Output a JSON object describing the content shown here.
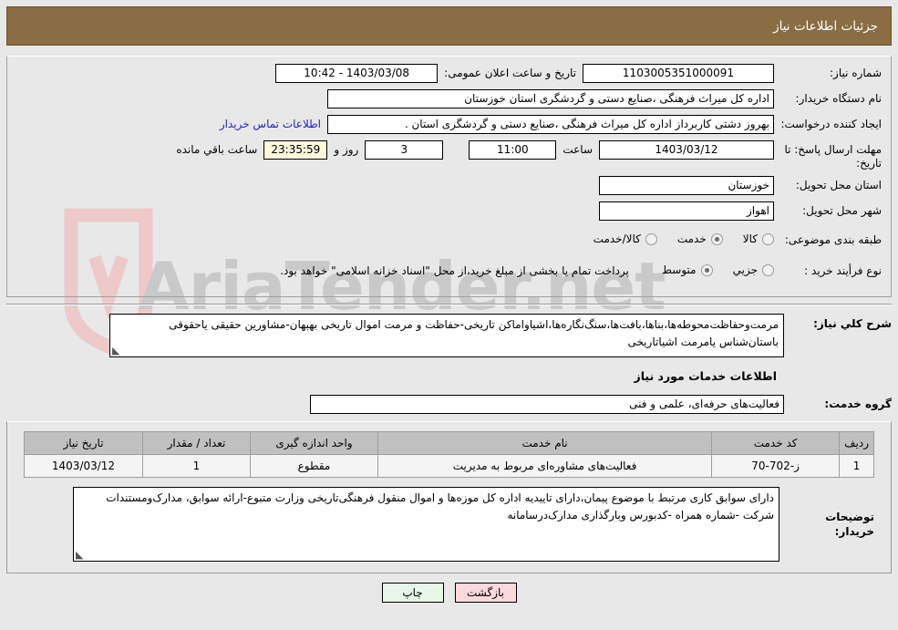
{
  "header": {
    "title": "جزئیات اطلاعات نیاز",
    "bar_color": "#8a6d43"
  },
  "watermark": {
    "text": "AriaTender.net"
  },
  "form": {
    "need_number": {
      "label": "شماره نیاز:",
      "value": "1103005351000091"
    },
    "public_announce": {
      "label": "تاریخ و ساعت اعلان عمومی:",
      "value": "1403/03/08 - 10:42"
    },
    "buyer_org": {
      "label": "نام دستگاه خریدار:",
      "value": "اداره کل میراث فرهنگی ،صنایع دستی و گردشگری استان خوزستان"
    },
    "requester": {
      "label": "ایجاد کننده درخواست:",
      "value": "بهروز دشتی کاربرداز اداره کل میراث فرهنگی ،صنایع دستی و گردشگری استان .",
      "contact_link": "اطلاعات تماس خریدار"
    },
    "deadline": {
      "label": "مهلت ارسال پاسخ: تا تاریخ:",
      "date": "1403/03/12",
      "hour_label": "ساعت",
      "hour": "11:00",
      "days": "3",
      "days_label": "روز و",
      "countdown": "23:35:59",
      "countdown_label": "ساعت باقي مانده"
    },
    "province": {
      "label": "استان محل تحویل:",
      "value": "خوزستان"
    },
    "city": {
      "label": "شهر محل تحویل:",
      "value": "اهواز"
    },
    "category": {
      "label": "طبقه بندی موضوعی:",
      "options": [
        "کالا",
        "خدمت",
        "کالا/خدمت"
      ],
      "selected": "خدمت"
    },
    "process_type": {
      "label": "نوع فرأیند خرید :",
      "options": [
        "جزیي",
        "متوسط"
      ],
      "selected": "متوسط",
      "note": "پرداخت تمام یا بخشی از مبلغ خرید،از محل \"اسناد خزانه اسلامی\" خواهد بود."
    },
    "general_desc": {
      "label": "شرح كلي نياز:",
      "value": "مرمت‌وحفاظت‌محوطه‌ها،بناها،بافت‌ها،سنگ‌نگاره‌ها،اشیاواماکن تاریخی-حفاظت و مرمت اموال تاریخی بهبهان-مشاورین حقیقی یاحقوقی باستان‌شناس یامرمت اشیاتاریخی"
    },
    "services_section_title": "اطلاعات خدمات مورد نیاز",
    "service_group": {
      "label": "گروه خدمت:",
      "value": "فعالیت‌های حرفه‌ای، علمی و فنی"
    },
    "buyer_notes": {
      "label": "توضیحات خریدار:",
      "value": "دارای سوابق کاری مرتبط با موضوع پیمان،دارای تاییدیه اداره کل موزه‌ها و اموال منقول فرهنگی‌تاریخی وزارت متبوع-ارائه سوابق، مدارک‌ومستندات شرکت -شماره همراه -کدبورس وبارگذاری مدارک‌درسامانه"
    }
  },
  "services_table": {
    "columns": [
      "ردیف",
      "کد خدمت",
      "نام خدمت",
      "واحد اندازه گیری",
      "تعداد / مقدار",
      "تاریخ نیاز"
    ],
    "rows": [
      {
        "index": "1",
        "code": "ز-702-70",
        "name": "فعالیت‌های مشاوره‌ای مربوط به مدیریت",
        "unit": "مقطوع",
        "qty": "1",
        "date": "1403/03/12"
      }
    ]
  },
  "footer": {
    "print_label": "چاپ",
    "back_label": "بازگشت",
    "print_color": "#e7f6e7",
    "back_color": "#fbd9da"
  }
}
